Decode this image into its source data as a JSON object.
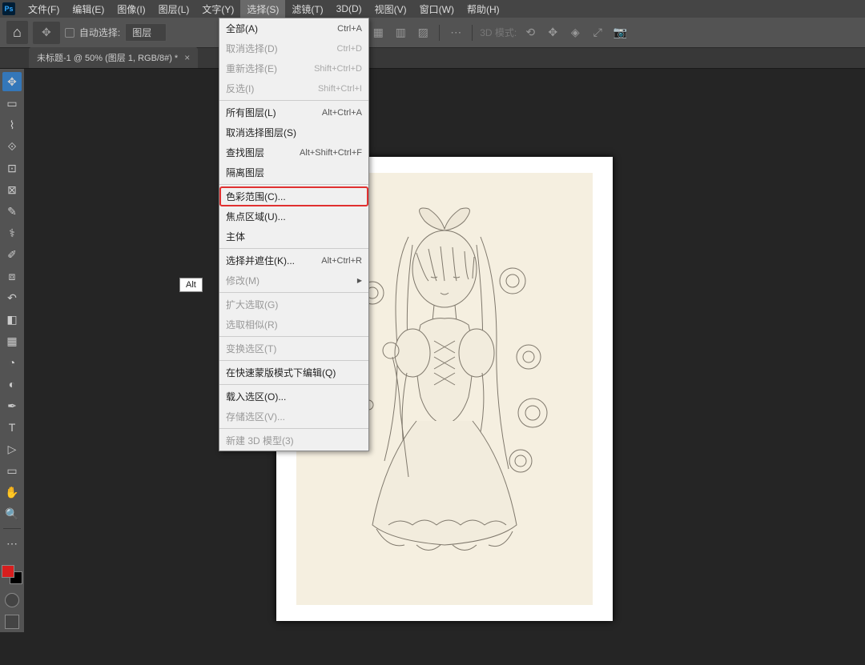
{
  "app_icon": "Ps",
  "menubar": [
    "文件(F)",
    "编辑(E)",
    "图像(I)",
    "图层(L)",
    "文字(Y)",
    "选择(S)",
    "滤镜(T)",
    "3D(D)",
    "视图(V)",
    "窗口(W)",
    "帮助(H)"
  ],
  "menubar_active_index": 5,
  "options": {
    "auto_select": "自动选择:",
    "layer_select": "图层",
    "mode_3d": "3D 模式:"
  },
  "doc_tab": {
    "title": "未标题-1 @ 50% (图层 1, RGB/8#) *",
    "close": "×"
  },
  "alt_tip": "Alt",
  "menu": {
    "items": [
      {
        "label": "全部(A)",
        "shortcut": "Ctrl+A",
        "disabled": false
      },
      {
        "label": "取消选择(D)",
        "shortcut": "Ctrl+D",
        "disabled": true
      },
      {
        "label": "重新选择(E)",
        "shortcut": "Shift+Ctrl+D",
        "disabled": true
      },
      {
        "label": "反选(I)",
        "shortcut": "Shift+Ctrl+I",
        "disabled": true
      }
    ],
    "items2": [
      {
        "label": "所有图层(L)",
        "shortcut": "Alt+Ctrl+A",
        "disabled": false
      },
      {
        "label": "取消选择图层(S)",
        "shortcut": "",
        "disabled": false
      },
      {
        "label": "查找图层",
        "shortcut": "Alt+Shift+Ctrl+F",
        "disabled": false
      },
      {
        "label": "隔离图层",
        "shortcut": "",
        "disabled": false
      }
    ],
    "items3": [
      {
        "label": "色彩范围(C)...",
        "shortcut": "",
        "disabled": false,
        "highlighted": true
      },
      {
        "label": "焦点区域(U)...",
        "shortcut": "",
        "disabled": false
      },
      {
        "label": "主体",
        "shortcut": "",
        "disabled": false
      }
    ],
    "items4": [
      {
        "label": "选择并遮住(K)...",
        "shortcut": "Alt+Ctrl+R",
        "disabled": false
      },
      {
        "label": "修改(M)",
        "shortcut": "",
        "disabled": true,
        "submenu": true
      }
    ],
    "items5": [
      {
        "label": "扩大选取(G)",
        "shortcut": "",
        "disabled": true
      },
      {
        "label": "选取相似(R)",
        "shortcut": "",
        "disabled": true
      }
    ],
    "items6": [
      {
        "label": "变换选区(T)",
        "shortcut": "",
        "disabled": true
      }
    ],
    "items7": [
      {
        "label": "在快速蒙版模式下编辑(Q)",
        "shortcut": "",
        "disabled": false
      }
    ],
    "items8": [
      {
        "label": "载入选区(O)...",
        "shortcut": "",
        "disabled": false
      },
      {
        "label": "存储选区(V)...",
        "shortcut": "",
        "disabled": true
      }
    ],
    "items9": [
      {
        "label": "新建 3D 模型(3)",
        "shortcut": "",
        "disabled": true
      }
    ]
  }
}
